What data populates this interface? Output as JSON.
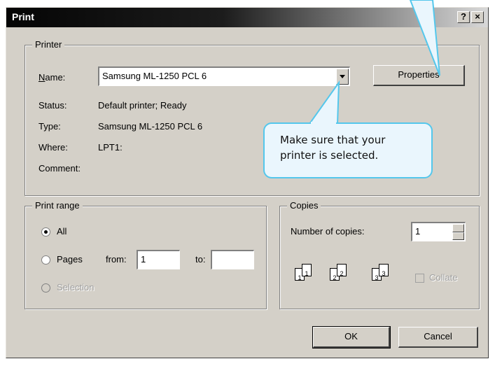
{
  "window": {
    "title": "Print",
    "help_button": "?",
    "close_button": "×"
  },
  "printer_group": {
    "legend": "Printer",
    "name_label": "Name:",
    "name_value": "Samsung ML-1250 PCL 6",
    "properties_button": "Properties",
    "status_label": "Status:",
    "status_value": "Default printer; Ready",
    "type_label": "Type:",
    "type_value": "Samsung ML-1250 PCL 6",
    "where_label": "Where:",
    "where_value": "LPT1:",
    "comment_label": "Comment:"
  },
  "print_range": {
    "legend": "Print range",
    "all_label": "All",
    "pages_label": "Pages",
    "from_label": "from:",
    "from_value": "1",
    "to_label": "to:",
    "to_value": "",
    "selection_label": "Selection",
    "selected": "all"
  },
  "copies": {
    "legend": "Copies",
    "number_label": "Number of copies:",
    "number_value": "1",
    "collate_label": "Collate",
    "collate_checked": false
  },
  "buttons": {
    "ok": "OK",
    "cancel": "Cancel"
  },
  "callout": {
    "line1": "Make sure that your",
    "line2": "printer is selected."
  },
  "colors": {
    "dialog_bg": "#d4d0c8",
    "callout_border": "#54c7ec",
    "callout_bg": "#eaf6fd"
  }
}
